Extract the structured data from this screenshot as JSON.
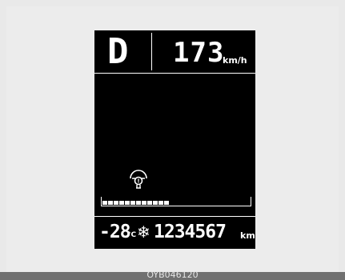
{
  "display": {
    "gear": "D",
    "speed": "173",
    "speed_unit": "km/h",
    "warning_icon": "power-steering-warning-icon",
    "fuel_level": 0.48,
    "outside_temp": "-28",
    "temp_unit": "°C",
    "snow_icon": "snowflake-icon",
    "odometer": "1234567",
    "odometer_unit": "km"
  },
  "caption": "OYB046120",
  "colors": {
    "lcd_background": "#000000",
    "segment": "#ffffff",
    "page_background": "#e9e9e9",
    "caption_bar": "#707070"
  }
}
